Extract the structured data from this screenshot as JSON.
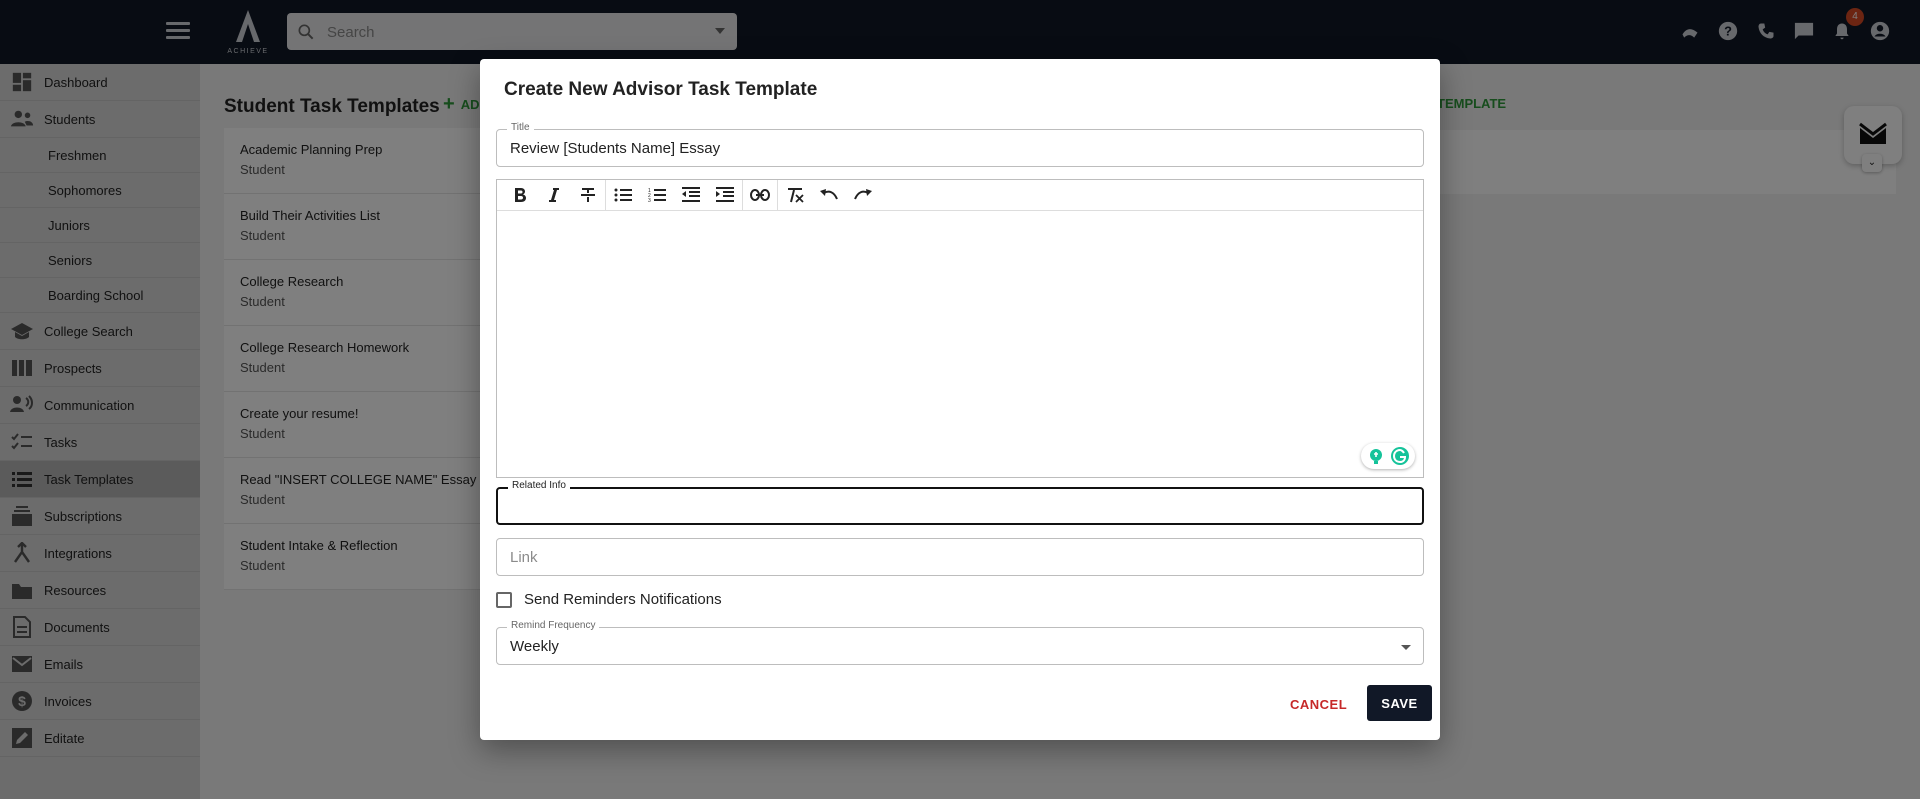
{
  "header": {
    "logo_text": "ACHIEVE",
    "search_placeholder": "Search",
    "notification_count": "4",
    "icons": [
      "menu-icon",
      "search-icon",
      "chevron-down-icon",
      "graduation-cap-icon",
      "help-icon",
      "phone-icon",
      "chat-icon",
      "bell-icon",
      "account-icon"
    ]
  },
  "sidebar": {
    "items": [
      {
        "label": "Dashboard",
        "icon": "dashboard-icon"
      },
      {
        "label": "Students",
        "icon": "students-icon"
      },
      {
        "label": "Freshmen"
      },
      {
        "label": "Sophomores"
      },
      {
        "label": "Juniors"
      },
      {
        "label": "Seniors"
      },
      {
        "label": "Boarding School"
      },
      {
        "label": "College Search",
        "icon": "school-icon"
      },
      {
        "label": "Prospects",
        "icon": "prospects-icon"
      },
      {
        "label": "Communication",
        "icon": "communication-icon"
      },
      {
        "label": "Tasks",
        "icon": "tasks-icon"
      },
      {
        "label": "Task Templates",
        "icon": "task-templates-icon",
        "active": true
      },
      {
        "label": "Subscriptions",
        "icon": "subscriptions-icon"
      },
      {
        "label": "Integrations",
        "icon": "integrations-icon"
      },
      {
        "label": "Resources",
        "icon": "resources-icon"
      },
      {
        "label": "Documents",
        "icon": "documents-icon"
      },
      {
        "label": "Emails",
        "icon": "emails-icon"
      },
      {
        "label": "Invoices",
        "icon": "invoices-icon"
      },
      {
        "label": "Editate",
        "icon": "editate-icon"
      }
    ]
  },
  "main": {
    "page_title": "Student Task Templates",
    "add_label": "AD",
    "add_label_right": "TEMPLATE",
    "templates": [
      {
        "title": "Academic Planning Prep",
        "subtitle": "Student"
      },
      {
        "title": "Build Their Activities List",
        "subtitle": "Student"
      },
      {
        "title": "College Research",
        "subtitle": "Student"
      },
      {
        "title": "College Research Homework",
        "subtitle": "Student"
      },
      {
        "title": "Create your resume!",
        "subtitle": "Student"
      },
      {
        "title": "Read \"INSERT COLLEGE NAME\" Essay Pro",
        "subtitle": "Student"
      },
      {
        "title": "Student Intake & Reflection",
        "subtitle": "Student"
      }
    ]
  },
  "dialog": {
    "title": "Create New Advisor Task Template",
    "title_field": {
      "label": "Title",
      "value": "Review [Students Name] Essay"
    },
    "editor_tools": [
      "bold-icon",
      "italic-icon",
      "strikethrough-icon",
      "bullet-list-icon",
      "numbered-list-icon",
      "outdent-icon",
      "indent-icon",
      "link-icon",
      "clear-format-icon",
      "undo-icon",
      "redo-icon"
    ],
    "related_info": {
      "label": "Related Info",
      "value": ""
    },
    "link_field": {
      "placeholder": "Link"
    },
    "reminders_label": "Send Reminders Notifications",
    "reminders_checked": false,
    "remind_frequency": {
      "label": "Remind Frequency",
      "value": "Weekly"
    },
    "cancel_label": "CANCEL",
    "save_label": "SAVE"
  },
  "colors": {
    "topbar": "#111827",
    "accent_green": "#2e9a3a",
    "cancel_red": "#c62828",
    "save_bg": "#111827",
    "badge": "#d84a25"
  }
}
